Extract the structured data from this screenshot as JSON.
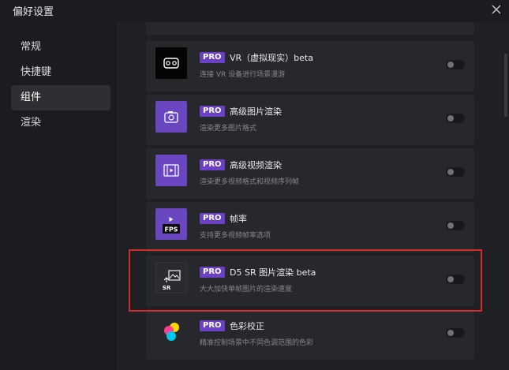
{
  "window": {
    "title": "偏好设置",
    "close_icon": "close-icon"
  },
  "sidebar": {
    "items": [
      {
        "label": "常规",
        "active": false
      },
      {
        "label": "快捷键",
        "active": false
      },
      {
        "label": "组件",
        "active": true
      },
      {
        "label": "渲染",
        "active": false
      }
    ]
  },
  "cards": [
    {
      "id": "partial-top",
      "title": "",
      "desc": "",
      "badge": "",
      "icon": "partial-card-icon"
    },
    {
      "id": "vr",
      "badge": "PRO",
      "title": "VR（虚拟现实）beta",
      "desc": "连接 VR 设备进行场景漫游",
      "icon": "vr-headset-icon",
      "enabled": false
    },
    {
      "id": "advanced-image",
      "badge": "PRO",
      "title": "高级图片渲染",
      "desc": "渲染更多图片格式",
      "icon": "camera-icon",
      "enabled": false
    },
    {
      "id": "advanced-video",
      "badge": "PRO",
      "title": "高级视频渲染",
      "desc": "渲染更多视频格式和视频序列帧",
      "icon": "film-icon",
      "enabled": false
    },
    {
      "id": "frame-rate",
      "badge": "PRO",
      "title": "帧率",
      "desc": "支持更多视频帧率选项",
      "icon": "fps-icon",
      "icon_text": "FPS",
      "enabled": false
    },
    {
      "id": "d5-sr",
      "badge": "PRO",
      "title": "D5 SR 图片渲染 beta",
      "desc": "大大加快单帧图片的渲染速度",
      "icon": "sr-image-icon",
      "icon_text": "SR",
      "enabled": false
    },
    {
      "id": "color-correction",
      "badge": "PRO",
      "title": "色彩校正",
      "desc": "精准控制场景中不同色调范围的色彩",
      "icon": "color-wheel-icon",
      "enabled": false
    }
  ],
  "colors": {
    "accent": "#6b3fc6",
    "highlight": "#d42a2a",
    "background": "#1f2023",
    "card": "#27282c"
  }
}
